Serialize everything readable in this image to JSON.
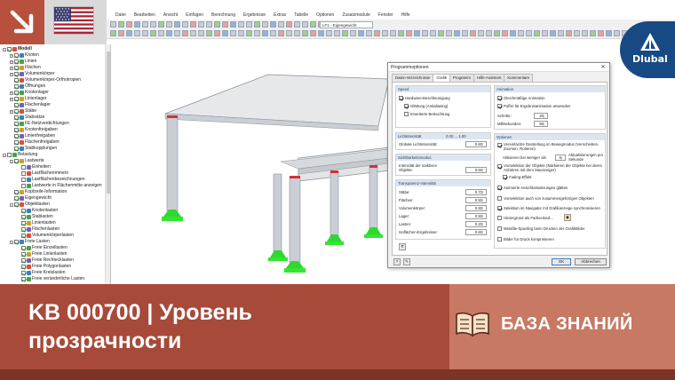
{
  "menu": [
    "Datei",
    "Bearbeiten",
    "Ansicht",
    "Einfügen",
    "Berechnung",
    "Ergebnisse",
    "Extras",
    "Tabelle",
    "Optionen",
    "Zusatzmodule",
    "Fenster",
    "Hilfe"
  ],
  "toolbar": {
    "loadcase": "LF1 - Eigengewicht"
  },
  "navigator": {
    "items": [
      {
        "label": "Modell",
        "level": 0,
        "tw": "-",
        "on": true,
        "bold": true
      },
      {
        "label": "Knoten",
        "level": 1,
        "tw": "+",
        "on": true
      },
      {
        "label": "Linien",
        "level": 1,
        "tw": "+",
        "on": true
      },
      {
        "label": "Flächen",
        "level": 1,
        "tw": "+",
        "on": true
      },
      {
        "label": "Volumenkörper",
        "level": 1,
        "tw": "+",
        "on": true
      },
      {
        "label": "Volumenkörper-Orthotropien",
        "level": 1,
        "tw": "",
        "on": true
      },
      {
        "label": "Öffnungen",
        "level": 1,
        "tw": "",
        "on": true
      },
      {
        "label": "Knotenlager",
        "level": 1,
        "tw": "+",
        "on": true
      },
      {
        "label": "Linienlager",
        "level": 1,
        "tw": "+",
        "on": true
      },
      {
        "label": "Flächenlager",
        "level": 1,
        "tw": "",
        "on": true
      },
      {
        "label": "Stäbe",
        "level": 1,
        "tw": "+",
        "on": true
      },
      {
        "label": "Stabsätze",
        "level": 1,
        "tw": "",
        "on": true
      },
      {
        "label": "FE-Netzverdichtungen",
        "level": 1,
        "tw": "",
        "on": true
      },
      {
        "label": "Knotenfreigaben",
        "level": 1,
        "tw": "",
        "on": true
      },
      {
        "label": "Linienfreigaben",
        "level": 1,
        "tw": "",
        "on": true
      },
      {
        "label": "Flächenfreigaben",
        "level": 1,
        "tw": "",
        "on": true
      },
      {
        "label": "Stabkopplungen",
        "level": 1,
        "tw": "",
        "on": true
      },
      {
        "label": "Belastung",
        "level": 0,
        "tw": "-",
        "on": false
      },
      {
        "label": "Lastwerte",
        "level": 1,
        "tw": "-",
        "on": true
      },
      {
        "label": "Einheiten",
        "level": 2,
        "tw": "",
        "on": false
      },
      {
        "label": "Lastflächenmmern",
        "level": 2,
        "tw": "",
        "on": false
      },
      {
        "label": "Lastflächenbezeichnungen",
        "level": 2,
        "tw": "",
        "on": false
      },
      {
        "label": "Lastwerte in Flächenmitte anzeigen",
        "level": 2,
        "tw": "",
        "on": false
      },
      {
        "label": "Kopfzeile-Information",
        "level": 1,
        "tw": "",
        "on": true
      },
      {
        "label": "Eigengewicht",
        "level": 1,
        "tw": "",
        "on": true
      },
      {
        "label": "Objektlasten",
        "level": 1,
        "tw": "-",
        "on": true
      },
      {
        "label": "Knotenlasten",
        "level": 2,
        "tw": "",
        "on": true
      },
      {
        "label": "Stablasten",
        "level": 2,
        "tw": "",
        "on": true
      },
      {
        "label": "Linienlasten",
        "level": 2,
        "tw": "",
        "on": true
      },
      {
        "label": "Flächenlasten",
        "level": 2,
        "tw": "",
        "on": true
      },
      {
        "label": "Volumenkörperlasten",
        "level": 2,
        "tw": "",
        "on": true
      },
      {
        "label": "Freie Lasten",
        "level": 1,
        "tw": "-",
        "on": true
      },
      {
        "label": "Freie Einzellasten",
        "level": 2,
        "tw": "",
        "on": true
      },
      {
        "label": "Freie Linienlasten",
        "level": 2,
        "tw": "",
        "on": true
      },
      {
        "label": "Freie Rechtecklasten",
        "level": 2,
        "tw": "",
        "on": true
      },
      {
        "label": "Freie Polygonlasten",
        "level": 2,
        "tw": "",
        "on": true
      },
      {
        "label": "Freie Kreislasten",
        "level": 2,
        "tw": "",
        "on": true
      },
      {
        "label": "Freie veränderliche Lasten",
        "level": 2,
        "tw": "",
        "on": true
      }
    ]
  },
  "dialog": {
    "title": "Programmoptionen",
    "close": "✕",
    "tabs": [
      "Daten-Verzeichnisse",
      "Grafik",
      "Programm",
      "Hilfe-Assistent",
      "Kommentare"
    ],
    "active_tab": 1,
    "speed": {
      "header": "Speed",
      "hardware": "Hardware-Beschleunigung",
      "smoothing": "Glättung (Antialiasing)",
      "lighting": "Erweiterte Beleuchtung"
    },
    "light": {
      "header": "Lichtintensität",
      "range": "0.00 ... 1.00",
      "global_label": "Globale Lichtintensität:",
      "global_value": "0.60"
    },
    "visibility": {
      "header": "Sichtbarkeitsmodus",
      "inactive_label": "Intensität der inaktiven Objekte:",
      "inactive_value": "0.60"
    },
    "transparency": {
      "header": "Transparenz-Intensität",
      "rows": [
        {
          "label": "Stäbe:",
          "value": "0.70"
        },
        {
          "label": "Flächen:",
          "value": "0.50"
        },
        {
          "label": "Volumenkörper:",
          "value": "0.50"
        },
        {
          "label": "Lager:",
          "value": "0.50"
        },
        {
          "label": "Lasten:",
          "value": "0.20"
        },
        {
          "label": "Isoflächen-Ergebnisse:",
          "value": "0.60"
        }
      ]
    },
    "animation": {
      "header": "Animation",
      "smooth": "Gleichmäßige Animation",
      "buffer": "Puffer für Ergebnisanimation anwenden",
      "steps_label": "Schritte:",
      "steps_value": "20",
      "ms_label": "Millisekunden:",
      "ms_value": "50"
    },
    "options": {
      "header": "Optionen",
      "simplified": "Vereinfachte Darstellung im Bewegmodus (Verschieben, Zoomen, Rotieren)",
      "activate_label": "Aktivieren bei weniger als",
      "activate_value": "5",
      "activate_unit": "Aktualisierungen pro Sekunde",
      "preselect": "Vorselektion der Objekte (Markieren der Objekte bei deren Anfahren mit dem Mauszeiger)",
      "fading": "Fading-Effekt",
      "animated": "Animierte Ansichtsänderungen glätten",
      "related": "Vorselektion auch von zusammengehörigen Objekten",
      "navigator_sync": "Selektion im Navigator mit Grafikanzeige synchronisieren",
      "bg_gradient": "Hintergrund als Farbverlauf...",
      "metafile": "Metafile-Spooling beim Drucken der Grafikbilder",
      "compress": "Bilder für Druck komprimieren"
    },
    "ok": "OK",
    "cancel": "Abbrechen"
  },
  "brand": {
    "name": "Dlubal"
  },
  "banner": {
    "title_line1": "KB 000700 | Уровень",
    "title_line2": "прозрачности",
    "category": "БАЗА ЗНАНИЙ"
  },
  "colors": {
    "banner": "#a84a39",
    "banner_accent": "#c77963",
    "banner_dark": "#7c3427",
    "dlubal_blue": "#174a82",
    "support_green": "#2ed82e",
    "member_gray": "#c9cfd4"
  }
}
